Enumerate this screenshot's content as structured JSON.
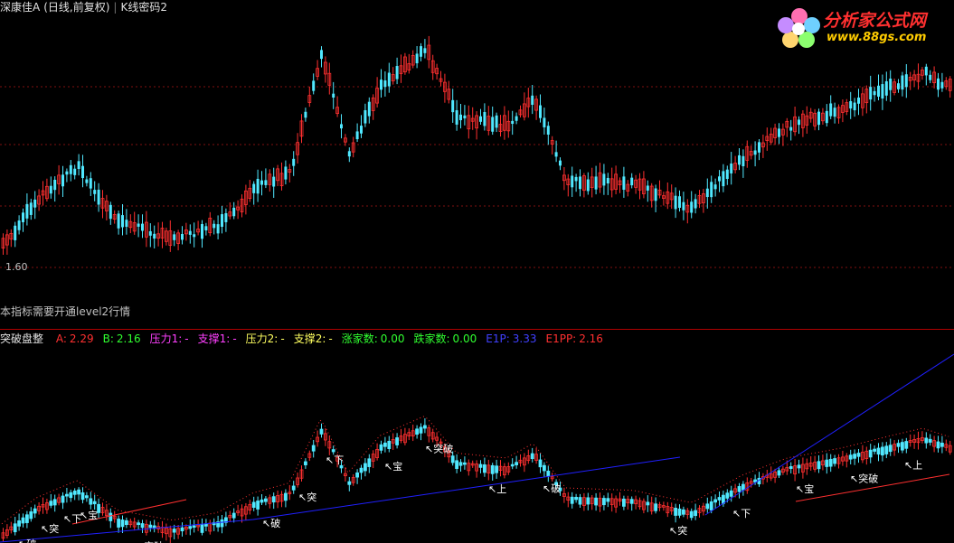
{
  "header": {
    "stock_name": "深康佳A",
    "period": "(日线,前复权)",
    "sep": "|",
    "indicator": "K线密码2"
  },
  "price_panel": {
    "low_label": "1.60"
  },
  "note": "本指标需要开通level2行情",
  "indicator_panel": {
    "name": "突破盘整",
    "values": [
      {
        "label": "A:",
        "value": "2.29",
        "color": "#ff3030"
      },
      {
        "label": "B:",
        "value": "2.16",
        "color": "#30ff30"
      },
      {
        "label": "压力1:",
        "value": "-",
        "color": "#ff40ff"
      },
      {
        "label": "支撑1:",
        "value": "-",
        "color": "#ff40ff"
      },
      {
        "label": "压力2:",
        "value": "-",
        "color": "#ffff60"
      },
      {
        "label": "支撑2:",
        "value": "-",
        "color": "#ffff60"
      },
      {
        "label": "涨家数:",
        "value": "0.00",
        "color": "#30ff30"
      },
      {
        "label": "跌家数:",
        "value": "0.00",
        "color": "#30ff30"
      },
      {
        "label": "E1P:",
        "value": "3.33",
        "color": "#4040ff"
      },
      {
        "label": "E1PP:",
        "value": "2.16",
        "color": "#ff3030"
      }
    ],
    "marker_labels": [
      "破",
      "突",
      "下",
      "宝",
      "突破",
      "上"
    ]
  },
  "logo": {
    "line1": "分析家公式网",
    "line2": "www.88gs.com"
  },
  "colors": {
    "up": "#ff3030",
    "down": "#50e8ff",
    "grid": "#801010",
    "blue_line": "#2020ff"
  }
}
